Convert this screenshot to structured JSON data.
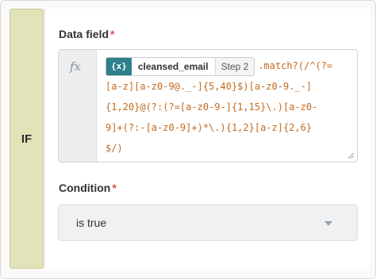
{
  "block": {
    "type_label": "IF"
  },
  "data_field": {
    "label": "Data field",
    "required_mark": "*",
    "fx_symbol": "fx",
    "pill": {
      "icon_text": "{x}",
      "name": "cleansed_email",
      "step": "Step 2"
    },
    "code_lines": [
      ".match?(/^(?=",
      "[a-z][a-z0-9@._-]{5,40}$)[a-z0-9._-]",
      "{1,20}@(?:(?=[a-z0-9-]{1,15}\\.)[a-z0-",
      "9]+(?:-[a-z0-9]+)*\\.){1,2}[a-z]{2,6}",
      "$/)"
    ]
  },
  "condition": {
    "label": "Condition",
    "required_mark": "*",
    "selected_value": "is true"
  },
  "colors": {
    "if_bar": "#e2e3b9",
    "pill_icon_bg": "#2f7f8c",
    "code_text": "#c36a1f",
    "required": "#d9534f"
  }
}
